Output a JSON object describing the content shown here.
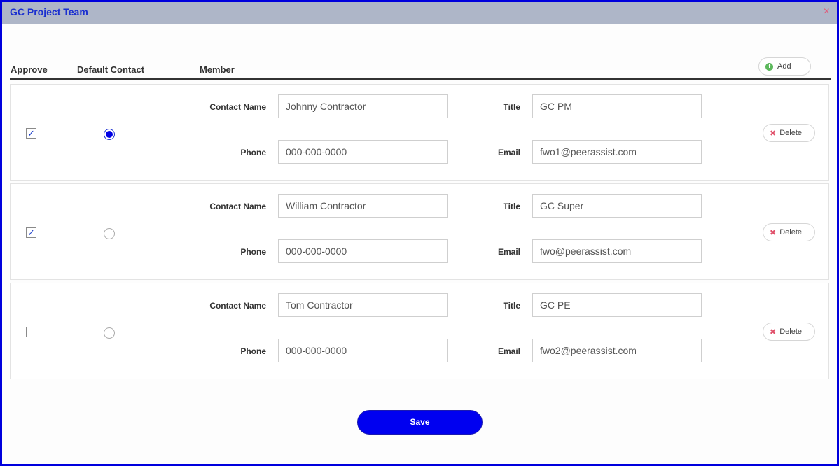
{
  "dialog": {
    "title": "GC Project Team",
    "close_label": "×"
  },
  "columns": {
    "approve": "Approve",
    "default_contact": "Default Contact",
    "member": "Member"
  },
  "add_button": {
    "label": "Add",
    "icon": "plus-circle-icon"
  },
  "field_labels": {
    "contact_name": "Contact Name",
    "title": "Title",
    "phone": "Phone",
    "email": "Email"
  },
  "delete_label": "Delete",
  "check_mark": "✓",
  "members": [
    {
      "approved": true,
      "default_contact": true,
      "contact_name": "Johnny Contractor",
      "title": "GC PM",
      "phone": "000-000-0000",
      "email": "fwo1@peerassist.com"
    },
    {
      "approved": true,
      "default_contact": false,
      "contact_name": "William Contractor",
      "title": "GC Super",
      "phone": "000-000-0000",
      "email": "fwo@peerassist.com"
    },
    {
      "approved": false,
      "default_contact": false,
      "contact_name": "Tom Contractor",
      "title": "GC PE",
      "phone": "000-000-0000",
      "email": "fwo2@peerassist.com"
    }
  ],
  "save_button": {
    "label": "Save"
  },
  "colors": {
    "accent_blue": "#0000f0",
    "titlebar": "#aeb6c8",
    "delete_red": "#e0506a",
    "add_green": "#5cb85c"
  }
}
